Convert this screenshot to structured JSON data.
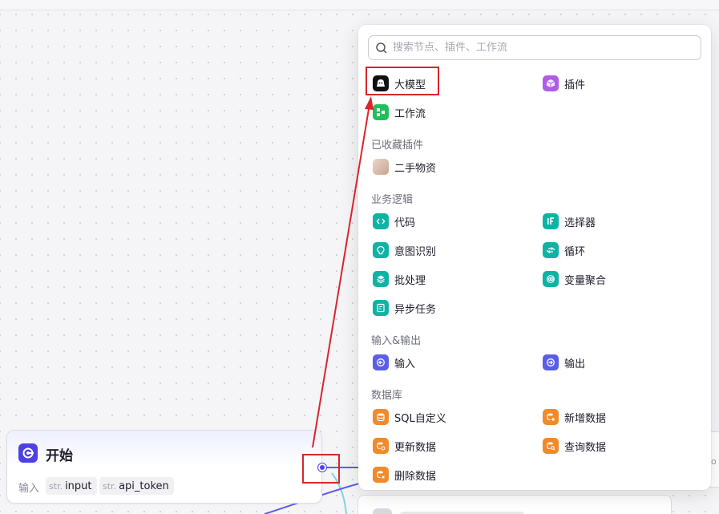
{
  "canvas": {
    "start_node": {
      "title": "开始",
      "input_label": "输入",
      "params": [
        {
          "type": "str.",
          "name": "input"
        },
        {
          "type": "str.",
          "name": "api_token"
        }
      ]
    }
  },
  "node_picker": {
    "search": {
      "placeholder": "搜索节点、插件、工作流",
      "value": ""
    },
    "top_items": {
      "llm": {
        "label": "大模型",
        "icon": "llm-icon"
      },
      "plugin": {
        "label": "插件",
        "icon": "plugin-cube-icon"
      },
      "workflow": {
        "label": "工作流",
        "icon": "workflow-icon"
      }
    },
    "favorite_plugins": {
      "title": "已收藏插件",
      "items": [
        {
          "label": "二手物资",
          "icon": "avatar-icon"
        }
      ]
    },
    "business_logic": {
      "title": "业务逻辑",
      "items": [
        {
          "label": "代码",
          "icon": "code-icon"
        },
        {
          "label": "选择器",
          "icon": "if-icon"
        },
        {
          "label": "意图识别",
          "icon": "intent-icon"
        },
        {
          "label": "循环",
          "icon": "loop-icon"
        },
        {
          "label": "批处理",
          "icon": "batch-icon"
        },
        {
          "label": "变量聚合",
          "icon": "variable-merge-icon"
        },
        {
          "label": "异步任务",
          "icon": "async-task-icon"
        }
      ]
    },
    "io": {
      "title": "输入&输出",
      "items": [
        {
          "label": "输入",
          "icon": "input-icon"
        },
        {
          "label": "输出",
          "icon": "output-icon"
        }
      ]
    },
    "database": {
      "title": "数据库",
      "items": [
        {
          "label": "SQL自定义",
          "icon": "sql-icon"
        },
        {
          "label": "新增数据",
          "icon": "db-add-icon"
        },
        {
          "label": "更新数据",
          "icon": "db-update-icon"
        },
        {
          "label": "查询数据",
          "icon": "db-query-icon"
        },
        {
          "label": "删除数据",
          "icon": "db-delete-icon"
        }
      ]
    }
  },
  "colors": {
    "accent": "#4e40e5",
    "teal": "#0fb3a4",
    "orange": "#f08a2a",
    "annotation_red": "#d9252a"
  }
}
